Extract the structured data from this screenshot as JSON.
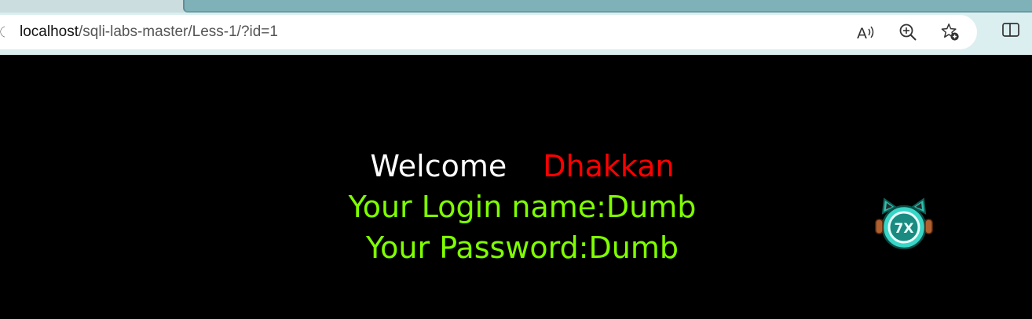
{
  "browser": {
    "url_host": "localhost",
    "url_path": "/sqli-labs-master/Less-1/?id=1",
    "toolbar_icons": [
      "read-aloud-icon",
      "zoom-icon",
      "favorites-add-icon",
      "split-screen-icon"
    ]
  },
  "page": {
    "welcome_label": "Welcome",
    "welcome_name": "Dhakkan",
    "login_line": "Your Login name:Dumb",
    "password_line": "Your Password:Dumb"
  },
  "colors": {
    "background": "#000000",
    "welcome": "#ffffff",
    "name": "#ff0000",
    "credentials": "#7fff00",
    "mascot": "#3fd6c6"
  },
  "mascot": {
    "glyph": "7X",
    "icon": "mascot-icon"
  }
}
